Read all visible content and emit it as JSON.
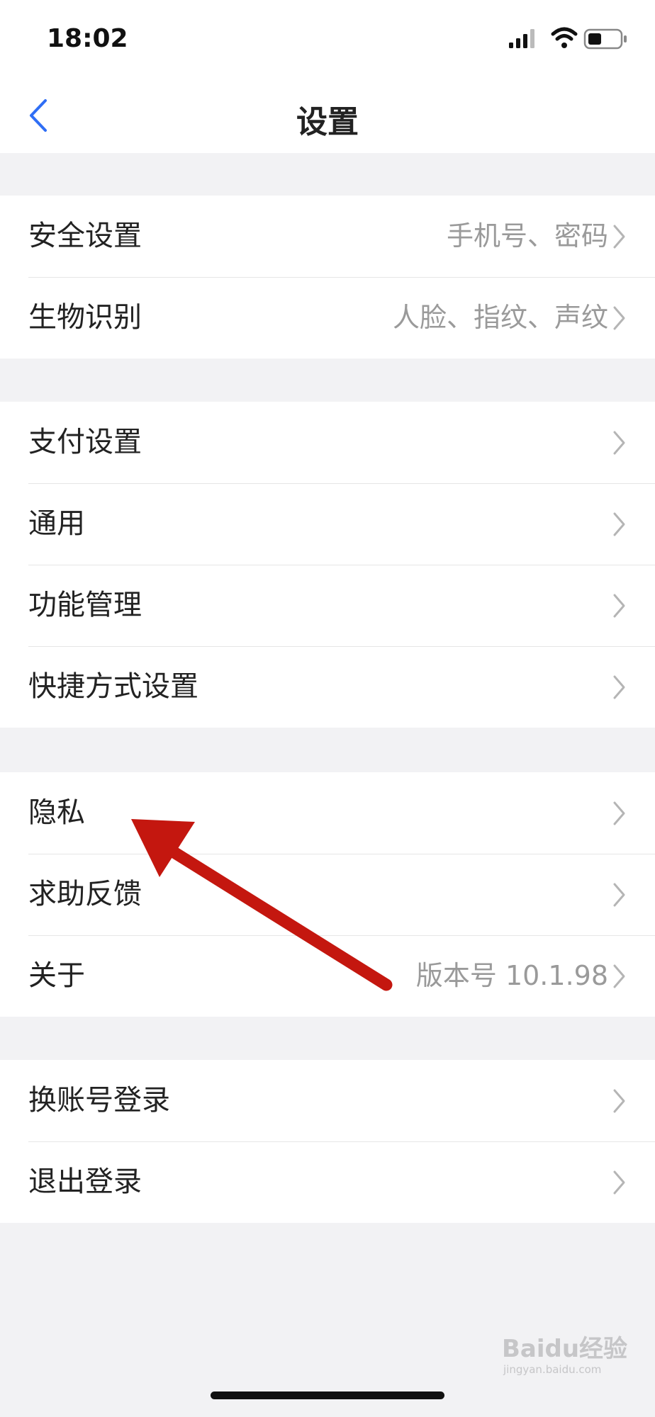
{
  "status_bar": {
    "time": "18:02"
  },
  "nav": {
    "title": "设置"
  },
  "groups": [
    {
      "items": [
        {
          "label": "安全设置",
          "value": "手机号、密码"
        },
        {
          "label": "生物识别",
          "value": "人脸、指纹、声纹"
        }
      ]
    },
    {
      "items": [
        {
          "label": "支付设置",
          "value": ""
        },
        {
          "label": "通用",
          "value": ""
        },
        {
          "label": "功能管理",
          "value": ""
        },
        {
          "label": "快捷方式设置",
          "value": ""
        }
      ]
    },
    {
      "items": [
        {
          "label": "隐私",
          "value": ""
        },
        {
          "label": "求助反馈",
          "value": ""
        },
        {
          "label": "关于",
          "value": "版本号 10.1.98"
        }
      ]
    },
    {
      "items": [
        {
          "label": "换账号登录",
          "value": ""
        },
        {
          "label": "退出登录",
          "value": ""
        }
      ]
    }
  ],
  "watermark": {
    "text": "Baidu经验",
    "sub": "jingyan.baidu.com"
  },
  "colors": {
    "accent": "#2f6ef5",
    "annotation": "#c4170f",
    "background": "#f2f2f4"
  }
}
